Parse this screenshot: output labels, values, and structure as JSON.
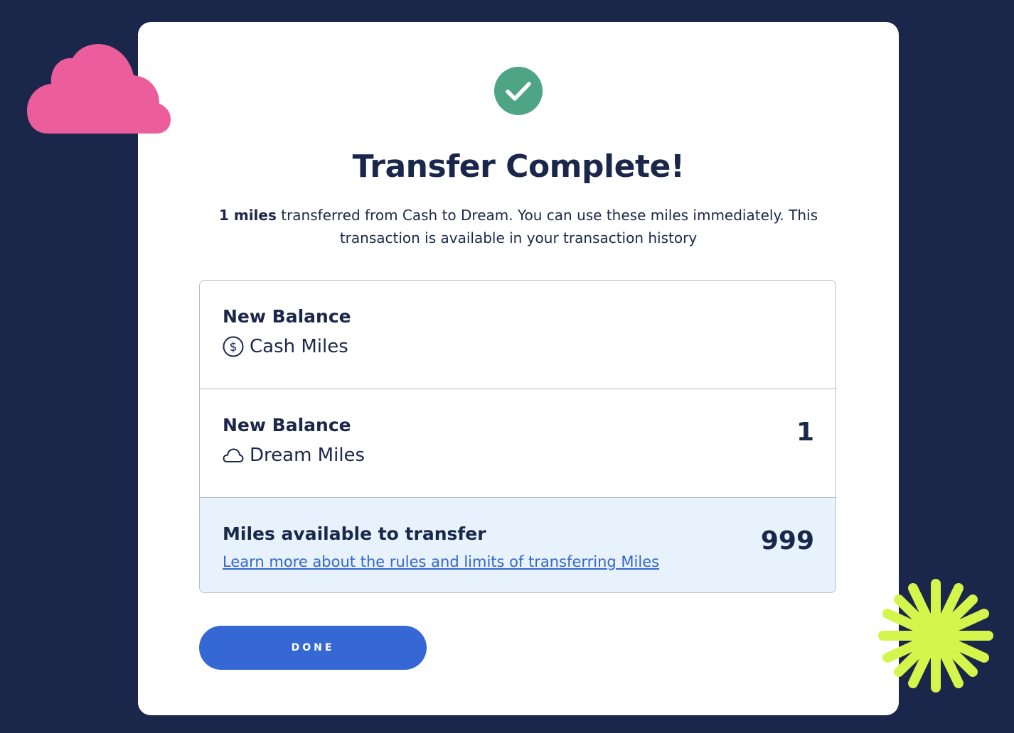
{
  "dialog": {
    "title": "Transfer Complete!",
    "message": {
      "amount": "1 miles",
      "text": " transferred from Cash to Dream. You can use these miles immediately. This transaction is available in your transaction history"
    }
  },
  "balances": {
    "cash": {
      "label": "New Balance",
      "currency": "Cash Miles",
      "icon": "dollar-circle-icon",
      "value": ""
    },
    "dream": {
      "label": "New Balance",
      "currency": "Dream Miles",
      "icon": "cloud-outline-icon",
      "value": "1"
    },
    "transfer": {
      "label": "Miles available to transfer",
      "link_text": "Learn more about the rules and limits of transferring Miles",
      "value": "999"
    }
  },
  "actions": {
    "done_label": "DONE"
  },
  "colors": {
    "background": "#1b274a",
    "card": "#ffffff",
    "success": "#4ea585",
    "primary_button": "#3568d4",
    "link": "#3566c9",
    "highlight_row": "#e7f2fd",
    "cloud_decoration": "#ec5d9c",
    "star_decoration": "#d4f54b"
  }
}
